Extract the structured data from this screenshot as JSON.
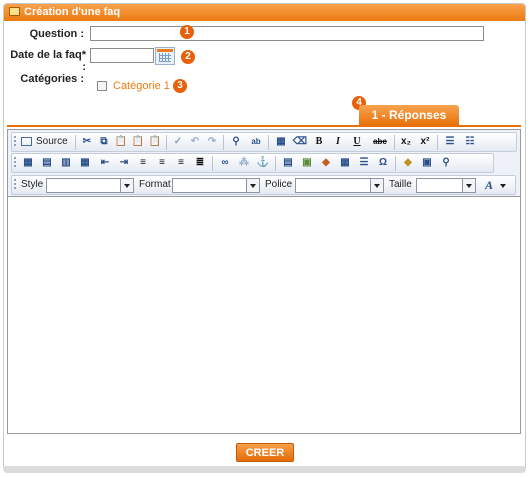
{
  "window": {
    "title": "Création d'une faq"
  },
  "form": {
    "question_label": "Question :",
    "question_value": "",
    "date_label": "Date de la faq* :",
    "date_value": "",
    "categories_label": "Catégories :",
    "category_option": "Catégorie 1",
    "category_checked": false
  },
  "badges": [
    "1",
    "2",
    "3",
    "4"
  ],
  "tab": {
    "label": "1 - Réponses"
  },
  "editor": {
    "source_label": "Source",
    "style_label": "Style",
    "format_label": "Format",
    "police_label": "Police",
    "taille_label": "Taille",
    "style_value": "",
    "format_value": "",
    "police_value": "",
    "taille_value": "",
    "bold": "B",
    "italic": "I",
    "underline": "U",
    "strike": "abc",
    "subscript": "x₂",
    "superscript": "x²",
    "omega": "Ω",
    "font_color": "A"
  },
  "actions": {
    "create_label": "CREER"
  },
  "colors": {
    "accent": "#ec7a12",
    "badge": "#e8600a",
    "category": "#f07c12"
  }
}
